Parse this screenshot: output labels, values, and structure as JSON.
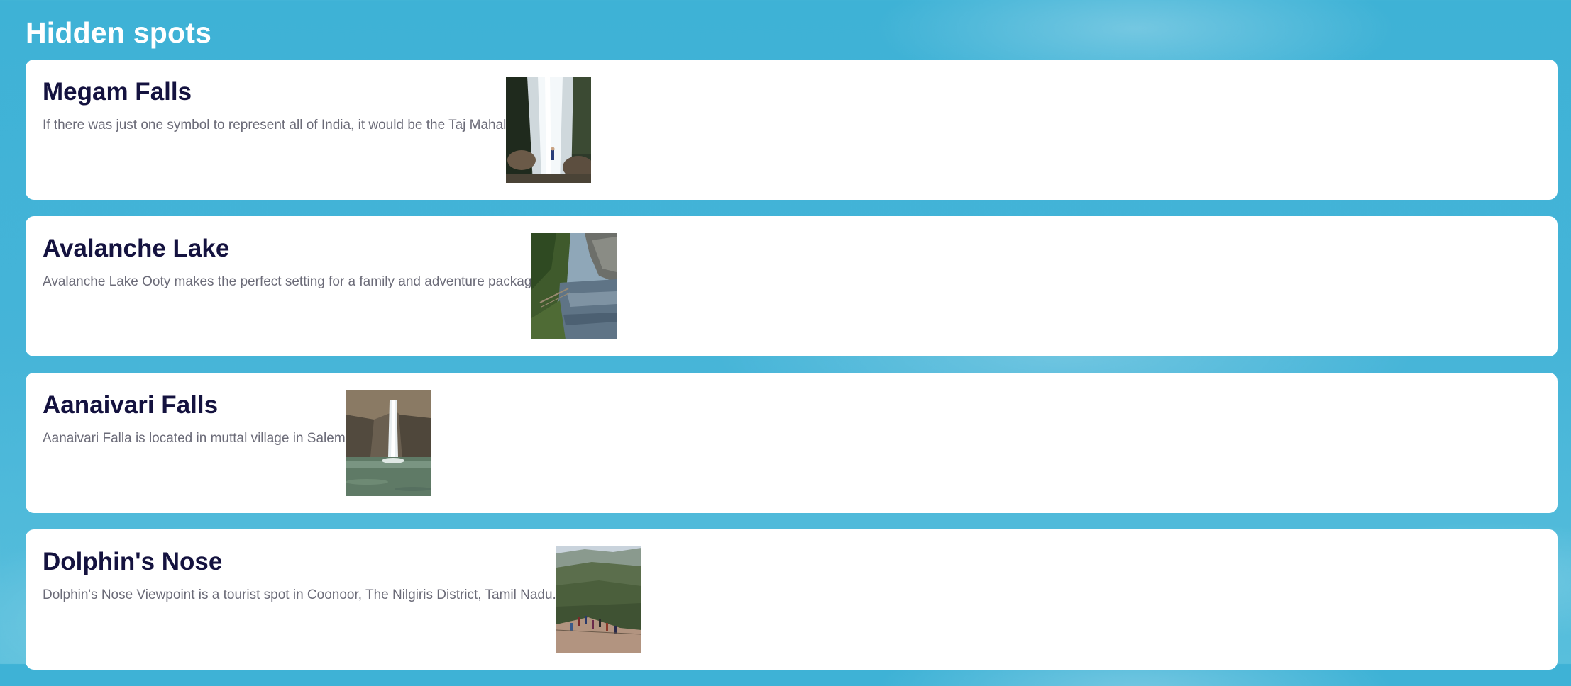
{
  "page": {
    "title": "Hidden spots"
  },
  "spots": [
    {
      "name": "Megam Falls",
      "description": "If there was just one symbol to represent all of India, it would be the Taj Mahal",
      "image_icon": "waterfall-photo"
    },
    {
      "name": "Avalanche Lake",
      "description": "Avalanche Lake Ooty makes the perfect setting for a family and adventure packag",
      "image_icon": "lake-photo"
    },
    {
      "name": "Aanaivari Falls",
      "description": "Aanaivari Falla is located in muttal village in Salem",
      "image_icon": "waterfall-pool-photo"
    },
    {
      "name": "Dolphin's Nose",
      "description": "Dolphin's Nose Viewpoint is a tourist spot in Coonoor, The Nilgiris District, Tamil Nadu.",
      "image_icon": "viewpoint-photo"
    }
  ],
  "colors": {
    "background": "#45b4d8",
    "card": "#ffffff",
    "title_text": "#14123f",
    "body_text": "#6b6b78"
  }
}
